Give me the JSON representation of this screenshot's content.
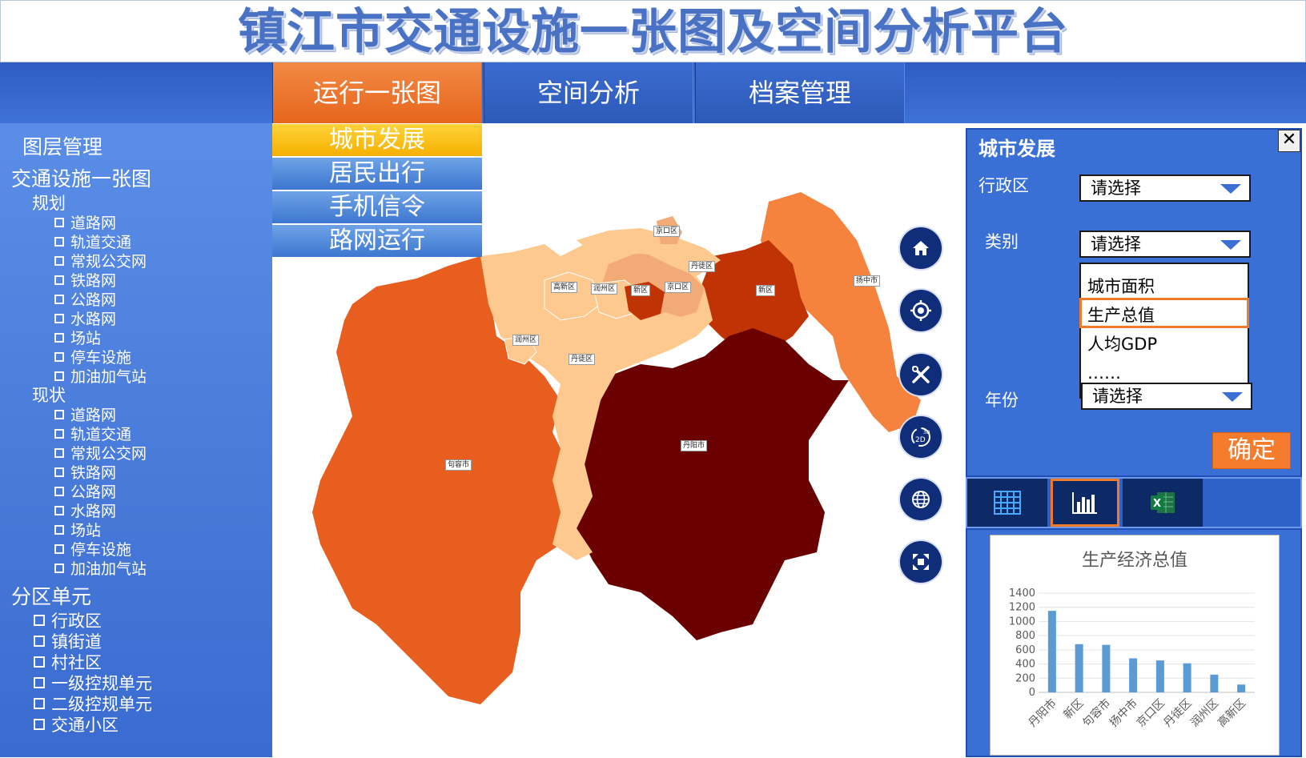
{
  "app": {
    "title": "镇江市交通设施一张图及空间分析平台"
  },
  "nav": {
    "tabs": [
      {
        "label": "运行一张图",
        "active": true
      },
      {
        "label": "空间分析",
        "active": false
      },
      {
        "label": "档案管理",
        "active": false
      }
    ]
  },
  "submenu": {
    "items": [
      {
        "label": "城市发展",
        "active": true
      },
      {
        "label": "居民出行",
        "active": false
      },
      {
        "label": "手机信令",
        "active": false
      },
      {
        "label": "路网运行",
        "active": false
      }
    ]
  },
  "sidebar": {
    "title": "图层管理",
    "group1": {
      "title": "交通设施一张图",
      "plan": {
        "title": "规划",
        "items": [
          "道路网",
          "轨道交通",
          "常规公交网",
          "铁路网",
          "公路网",
          "水路网",
          "场站",
          "停车设施",
          "加油加气站"
        ]
      },
      "current": {
        "title": "现状",
        "items": [
          "道路网",
          "轨道交通",
          "常规公交网",
          "铁路网",
          "公路网",
          "水路网",
          "场站",
          "停车设施",
          "加油加气站"
        ]
      }
    },
    "group2": {
      "title": "分区单元",
      "items": [
        "行政区",
        "镇街道",
        "村社区",
        "一级控规单元",
        "二级控规单元",
        "交通小区"
      ]
    }
  },
  "map": {
    "labels": [
      "京口区",
      "丹徒区",
      "扬中市",
      "高新区",
      "润州区",
      "新区",
      "京口区",
      "新区",
      "润州区",
      "丹徒区",
      "句容市",
      "丹阳市"
    ],
    "colors": {
      "darkest": "#6b0000",
      "dark": "#c03304",
      "mid": "#e85e1e",
      "light": "#f5833e",
      "lighter": "#f2ab77",
      "lightest": "#fdc98e"
    },
    "tools": [
      "home-icon",
      "locate-icon",
      "tools-icon",
      "2d-3d-icon",
      "globe-icon",
      "fullscreen-icon"
    ]
  },
  "panel": {
    "title": "城市发展",
    "close": "✕",
    "district": {
      "label": "行政区",
      "value": "请选择"
    },
    "category": {
      "label": "类别",
      "value": "请选择",
      "options": [
        "城市面积",
        "生产总值",
        "人均GDP",
        "……"
      ],
      "highlighted": "生产总值"
    },
    "year": {
      "label": "年份",
      "value": "请选择"
    },
    "confirm": "确定"
  },
  "icons": [
    "table-icon",
    "bar-chart-icon",
    "excel-icon"
  ],
  "chart_data": {
    "type": "bar",
    "title": "生产经济总值",
    "categories": [
      "丹阳市",
      "新区",
      "句容市",
      "扬中市",
      "京口区",
      "丹徒区",
      "润州区",
      "高新区"
    ],
    "values": [
      1150,
      680,
      670,
      480,
      450,
      410,
      250,
      110
    ],
    "ylim": [
      0,
      1400
    ],
    "yticks": [
      "1400",
      "1200",
      "1000",
      "800",
      "600",
      "400",
      "200",
      "0"
    ],
    "color": "#5b9bd5",
    "grid": true,
    "xlabel": "",
    "ylabel": ""
  }
}
